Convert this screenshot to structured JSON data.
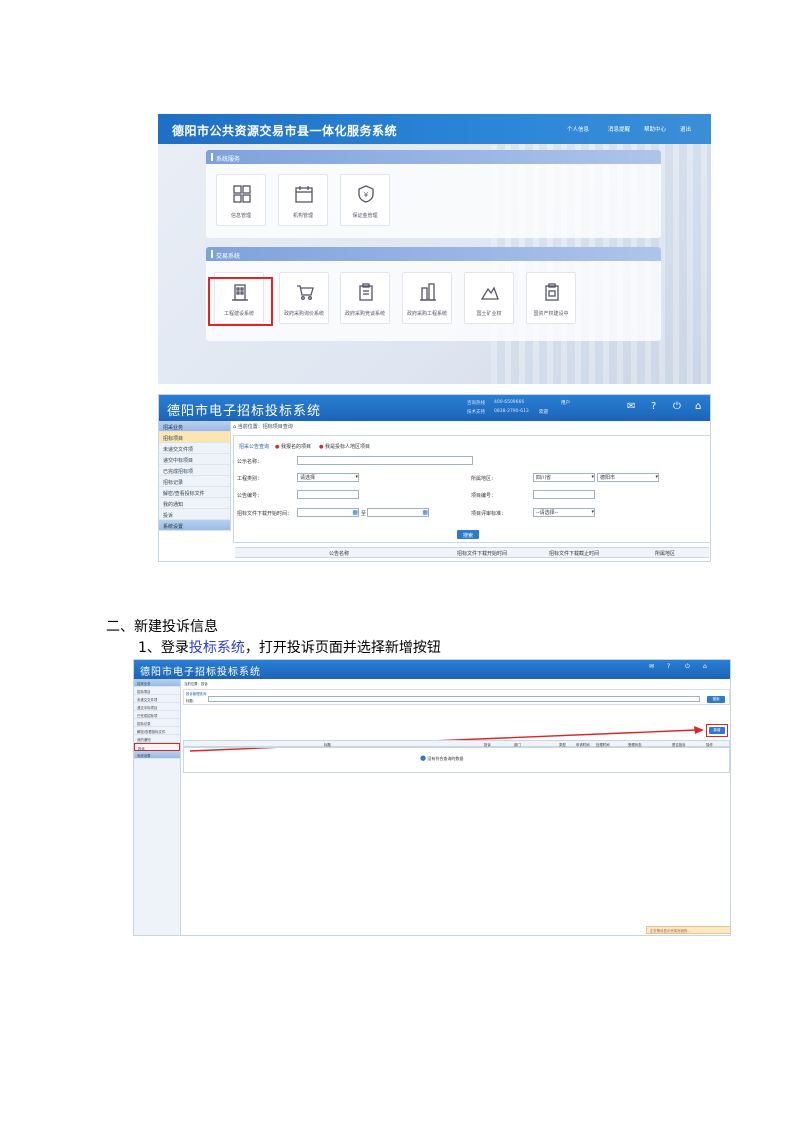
{
  "portal": {
    "title": "德阳市公共资源交易市县一体化服务系统",
    "nav": [
      "个人信息",
      "消息提醒",
      "帮助中心",
      "退出"
    ],
    "service_section": "系统服务",
    "service_tiles": [
      "信息管理",
      "机构管理",
      "保证金管理"
    ],
    "trade_section": "交易系统",
    "trade_tiles": [
      "工程建设系统",
      "政府采购询价系统",
      "政府采购竞谈系统",
      "政府采购工程系统",
      "国土矿业权",
      "国资产权建设中"
    ]
  },
  "bid_system": {
    "title": "德阳市电子招标投标系统",
    "hotline_label": "咨询热线",
    "hotline_value": "400-6509666",
    "tech_label": "技术支持",
    "tech_value": "0838-2790-613",
    "user_label": "用户",
    "welcome_label": "欢迎",
    "breadcrumb": "当前位置：招标项目查询",
    "sidebar": [
      "招采业务",
      "招标项目",
      "未递交文件项",
      "递交中标项目",
      "已完成招标项",
      "招标记录",
      "解密/查看投标文件",
      "我的通知",
      "投诉",
      "系统设置"
    ],
    "tabs": [
      "招采公告查询",
      "我报名的项目",
      "我是投标人地区项目"
    ],
    "fields": {
      "notice_name": "公示名称：",
      "project_type": "工程类别：",
      "project_type_value": "请选择",
      "region": "所属地区：",
      "region_value1": "四川省",
      "region_value2": "德阳市",
      "notice_no": "公告编号：",
      "bid_no": "项目编号：",
      "file_time": "招标文件下载开始时间：",
      "to": "至",
      "bid_method": "项目评审标准：",
      "bid_method_value": "--请选择--"
    },
    "search_button": "搜索",
    "columns": [
      "公告名称",
      "招标文件下载开始时间",
      "招标文件下载截止时间",
      "所属地区"
    ]
  },
  "section_heading": "二、新建投诉信息",
  "step": {
    "prefix": "1、登录",
    "link": "投标系统",
    "suffix": "，打开投诉页面并选择新增按钮"
  },
  "complaint_page": {
    "title": "德阳市电子招标投标系统",
    "breadcrumb": "当前位置：投诉",
    "panel_title": "投诉管理查询",
    "search_label": "标题：",
    "search_button": "搜索",
    "add_button": "新增",
    "columns": [
      "标题",
      "投诉",
      "部门",
      "类型",
      "申请时间",
      "处理时间",
      "受理状态",
      "是否投诉",
      "操作"
    ],
    "empty_msg": "没有符合查询的数据",
    "status_bar": "正在等待显示完成页面的…",
    "sidebar": [
      "招采业务",
      "招标项目",
      "未递交文件项",
      "递交中标项目",
      "已完成招标项",
      "招标记录",
      "解密/查看投标文件",
      "我的通知",
      "投诉",
      "系统设置"
    ]
  },
  "colors": {
    "header_blue": "#1b64b8",
    "highlight_red": "#e02424",
    "link_blue": "#2b3cd6"
  }
}
